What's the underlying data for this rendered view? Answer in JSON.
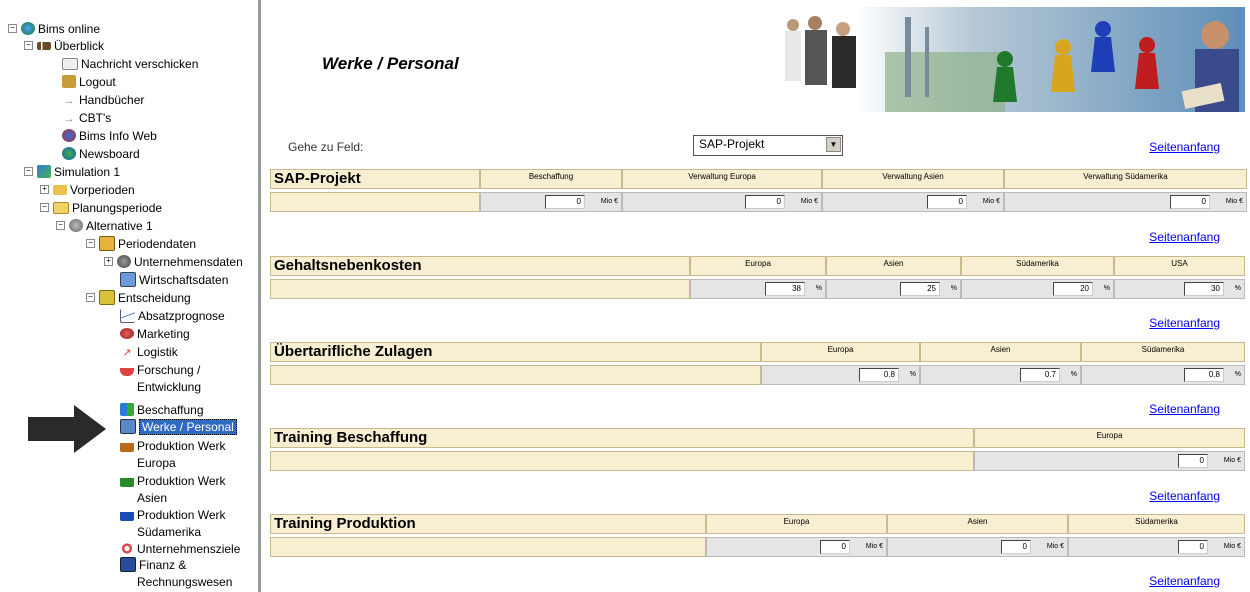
{
  "sidebar": {
    "items": [
      {
        "label": "Bims online",
        "toggle": "⊟",
        "icon": "globe-icon"
      },
      {
        "label": "Überblick",
        "toggle": "⊟",
        "icon": "overview-icon"
      },
      {
        "label": "Nachricht verschicken",
        "icon": "envelope-icon"
      },
      {
        "label": "Logout",
        "icon": "logout-icon"
      },
      {
        "label": "Handbücher",
        "icon": "link-icon"
      },
      {
        "label": "CBT's",
        "icon": "link-icon"
      },
      {
        "label": "Bims Info Web",
        "icon": "info-web-icon"
      },
      {
        "label": "Newsboard",
        "icon": "newsboard-icon"
      },
      {
        "label": "Simulation 1",
        "toggle": "⊟",
        "icon": "simulation-icon"
      },
      {
        "label": "Vorperioden",
        "toggle": "⊞",
        "icon": "folder-icon"
      },
      {
        "label": "Planungsperiode",
        "toggle": "⊟",
        "icon": "folder-open-icon"
      },
      {
        "label": "Alternative 1",
        "toggle": "⊟",
        "icon": "alternative-icon"
      },
      {
        "label": "Periodendaten",
        "toggle": "⊟",
        "icon": "book-icon"
      },
      {
        "label": "Unternehmensdaten",
        "toggle": "⊞",
        "icon": "company-icon"
      },
      {
        "label": "Wirtschaftsdaten",
        "icon": "economy-icon"
      },
      {
        "label": "Entscheidung",
        "toggle": "⊟",
        "icon": "decision-icon"
      },
      {
        "label": "Absatzprognose",
        "icon": "chart-icon"
      },
      {
        "label": "Marketing",
        "icon": "marketing-icon"
      },
      {
        "label": "Logistik",
        "icon": "logistics-icon"
      },
      {
        "label": "Forschung /",
        "label2": "Entwicklung",
        "icon": "research-icon"
      },
      {
        "label": "Beschaffung",
        "icon": "procurement-icon"
      },
      {
        "label": "Werke / Personal",
        "icon": "personnel-icon",
        "selected": true
      },
      {
        "label": "Produktion Werk",
        "label2": "Europa",
        "icon": "factory-icon"
      },
      {
        "label": "Produktion Werk",
        "label2": "Asien",
        "icon": "factory-icon"
      },
      {
        "label": "Produktion Werk",
        "label2": "Südamerika",
        "icon": "factory-icon"
      },
      {
        "label": "Unternehmensziele",
        "icon": "target-icon"
      },
      {
        "label": "Finanz &",
        "label2": "Rechnungswesen",
        "icon": "finance-icon"
      }
    ]
  },
  "main": {
    "title": "Werke / Personal",
    "goto_label": "Gehe zu Feld:",
    "goto_value": "SAP-Projekt",
    "top_link": "Seitenanfang",
    "sections": [
      {
        "title": "SAP-Projekt",
        "columns": [
          "Beschaffung",
          "Verwaltung Europa",
          "Verwaltung Asien",
          "Verwaltung Südamerika"
        ],
        "values": [
          "0",
          "0",
          "0",
          "0"
        ],
        "unit": "Mio €"
      },
      {
        "title": "Gehaltsnebenkosten",
        "columns": [
          "Europa",
          "Asien",
          "Südamerika",
          "USA"
        ],
        "values": [
          "38",
          "25",
          "20",
          "30"
        ],
        "unit": "%"
      },
      {
        "title": "Übertarifliche Zulagen",
        "columns": [
          "Europa",
          "Asien",
          "Südamerika"
        ],
        "values": [
          "0.8",
          "0.7",
          "0.8"
        ],
        "unit": "%"
      },
      {
        "title": "Training Beschaffung",
        "columns": [
          "Europa"
        ],
        "values": [
          "0"
        ],
        "unit": "Mio €"
      },
      {
        "title": "Training Produktion",
        "columns": [
          "Europa",
          "Asien",
          "Südamerika"
        ],
        "values": [
          "0",
          "0",
          "0"
        ],
        "unit": "Mio €"
      }
    ]
  },
  "colors": {
    "header_bg": "#f8eed1",
    "value_bg": "#e5e5e5",
    "link": "#0000ff",
    "selection": "#316ac5"
  }
}
